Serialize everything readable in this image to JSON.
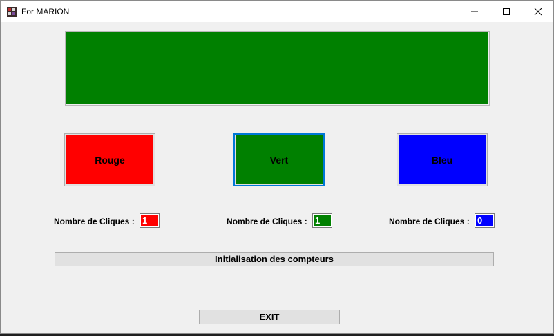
{
  "window": {
    "title": "For MARION",
    "controls": [
      "minimize",
      "maximize",
      "close"
    ]
  },
  "display": {
    "color": "#008000"
  },
  "buttons": [
    {
      "label": "Rouge",
      "color": "#ff0000"
    },
    {
      "label": "Vert",
      "color": "#008000"
    },
    {
      "label": "Bleu",
      "color": "#0000ff"
    }
  ],
  "counters": [
    {
      "label": "Nombre de Cliques :",
      "value": "1",
      "color": "#ff0000"
    },
    {
      "label": "Nombre de Cliques :",
      "value": "1",
      "color": "#008000"
    },
    {
      "label": "Nombre de Cliques :",
      "value": "0",
      "color": "#0000ff"
    }
  ],
  "reset_label": "Initialisation des compteurs",
  "exit_label": "EXIT"
}
